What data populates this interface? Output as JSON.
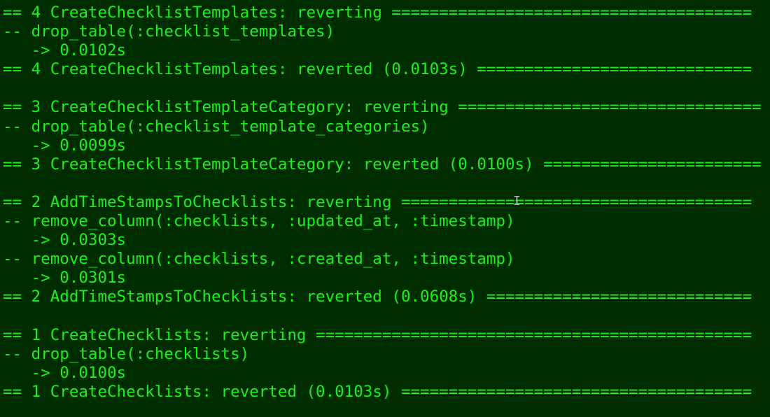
{
  "terminal": {
    "lines": [
      "== 4 CreateChecklistTemplates: reverting ======================================",
      "-- drop_table(:checklist_templates)",
      "   -> 0.0102s",
      "== 4 CreateChecklistTemplates: reverted (0.0103s) =============================",
      "",
      "== 3 CreateChecklistTemplateCategory: reverting ================================",
      "-- drop_table(:checklist_template_categories)",
      "   -> 0.0099s",
      "== 3 CreateChecklistTemplateCategory: reverted (0.0100s) =======================",
      "",
      "== 2 AddTimeStampsToChecklists: reverting =====================================",
      "-- remove_column(:checklists, :updated_at, :timestamp)",
      "   -> 0.0303s",
      "-- remove_column(:checklists, :created_at, :timestamp)",
      "   -> 0.0301s",
      "== 2 AddTimeStampsToChecklists: reverted (0.0608s) ============================",
      "",
      "== 1 CreateChecklists: reverting ==============================================",
      "-- drop_table(:checklists)",
      "   -> 0.0100s",
      "== 1 CreateChecklists: reverted (0.0103s) ====================================="
    ],
    "cursor_glyph": "I",
    "colors": {
      "background": "#002d00",
      "foreground": "#1bf01b"
    }
  }
}
